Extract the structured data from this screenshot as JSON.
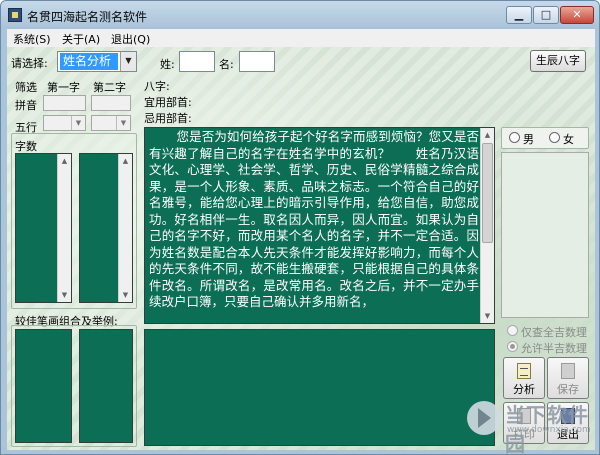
{
  "window": {
    "title": "名贯四海起名测名软件",
    "buttons": {
      "minimize": "▁",
      "maximize": "□",
      "close": "✕"
    }
  },
  "menu": [
    {
      "label": "系统(S)"
    },
    {
      "label": "关于(A)"
    },
    {
      "label": "退出(Q)"
    }
  ],
  "form": {
    "select_label": "请选择:",
    "select_value": "姓名分析",
    "surname_label": "姓:",
    "surname_value": "",
    "givenname_label": "名:",
    "givenname_value": "",
    "bazi_button": "生辰八字"
  },
  "left_panel": {
    "filter_label": "筛选",
    "col1": "第一字",
    "col2": "第二字",
    "pinyin_label": "拼音",
    "wuxing_label": "五行",
    "strokes_label": "字数",
    "combo_label": "较佳笔画组合及举例:"
  },
  "info": {
    "bazi_label": "八字:",
    "suitable_label": "宜用部首:",
    "avoid_label": "忌用部首:"
  },
  "intro_text": "您是否为如何给孩子起个好名字而感到烦恼？您又是否有兴趣了解自己的名字在姓名学中的玄机？　　姓名乃汉语文化、心理学、社会学、哲学、历史、民俗学精髓之综合成果，是一个人形象、素质、品味之标志。一个符合自己的好名雅号，能给您心理上的暗示引导作用，给您自信，助您成功。好名相伴一生。取名因人而异，因人而宜。如果认为自己的名字不好，而改用某个名人的名字，并不一定合适。因为姓名数是配合本人先天条件才能发挥好影响力，而每个人的先天条件不同，故不能生搬硬套，只能根据自己的具体条件改名。所谓改名，是改常用名。改名之后，并不一定办手续改户口簿，只要自己确认并多用新名，",
  "right_panel": {
    "male_label": "男",
    "female_label": "女",
    "option1_label": "仅查全吉数理",
    "option2_label": "允许半吉数理",
    "analyze_button": "分析",
    "save_button": "保存",
    "print_button": "打印",
    "exit_button": "退出"
  },
  "watermark": {
    "text": "当下软件园",
    "url": "www.downxia.com"
  },
  "colors": {
    "title_bg": "#aac4d9",
    "list_green": "#0b6e55",
    "selection_blue": "#3399ff"
  }
}
